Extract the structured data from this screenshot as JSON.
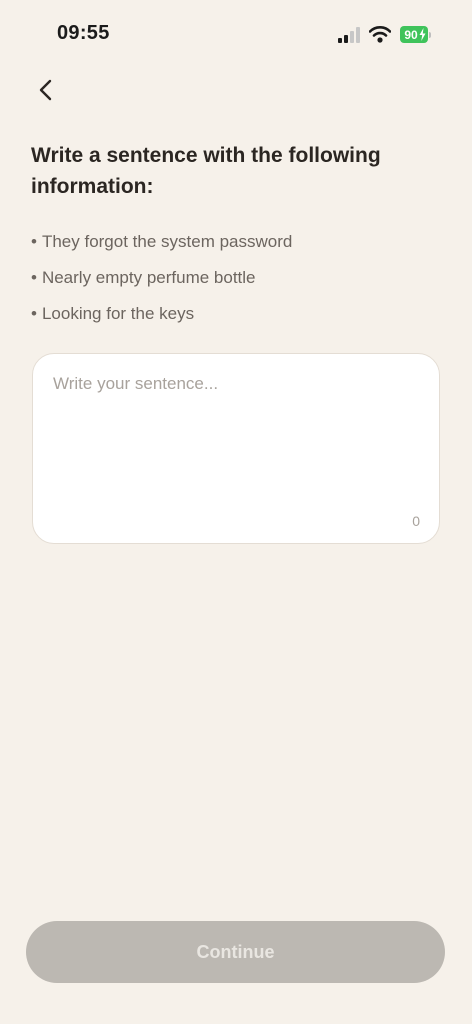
{
  "status_bar": {
    "time": "09:55",
    "battery_level": "90",
    "battery_color": "#3fc35b"
  },
  "nav": {
    "back_icon": "chevron-left-icon"
  },
  "prompt": {
    "title": "Write a sentence with the following information:",
    "bullet_glyph": "•",
    "items": [
      "They forgot the system password",
      "Nearly empty perfume bottle",
      "Looking for the keys"
    ]
  },
  "sentence_input": {
    "placeholder": "Write your sentence...",
    "value": "",
    "char_count": "0"
  },
  "footer": {
    "continue_label": "Continue",
    "continue_enabled": false
  },
  "colors": {
    "background": "#f6f1ea",
    "button_disabled": "#bcb8b2"
  }
}
